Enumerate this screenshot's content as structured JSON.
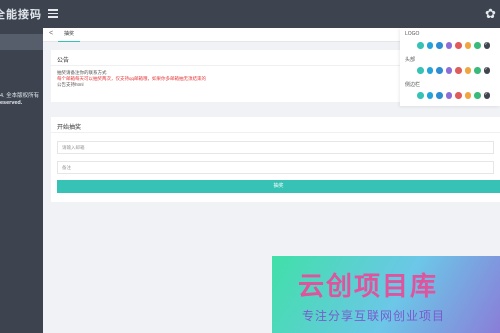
{
  "app": {
    "brand": "全能接码"
  },
  "tabbar": {
    "back_icon": "<",
    "active_tab": "抽奖"
  },
  "sidebar": {
    "footer_line1": "4. 全本版权所有",
    "footer_line2": "eserved."
  },
  "notice": {
    "title": "公告",
    "line1": "抽奖请备注你的联系方式",
    "line2": "每个邮箱每天可以抽奖两次，仅支持qq邮箱哦，如果你多邮箱抽无须结束的",
    "line3": "公告支持html"
  },
  "form": {
    "title": "开始抽奖",
    "email_placeholder": "请输入邮箱",
    "remark_placeholder": "备注",
    "submit_label": "抽奖"
  },
  "theme": {
    "logo_label": "LOGO",
    "header_label": "头部",
    "sidebar_label": "侧边栏",
    "swatch_colors": [
      "#36c2b4",
      "#23a3d9",
      "#2e8cd1",
      "#8c6fd6",
      "#e05b5b",
      "#f0a540",
      "#3aba7a",
      "#41454f"
    ]
  },
  "watermark": {
    "title": "云创项目库",
    "subtitle": "专注分享互联网创业项目"
  }
}
